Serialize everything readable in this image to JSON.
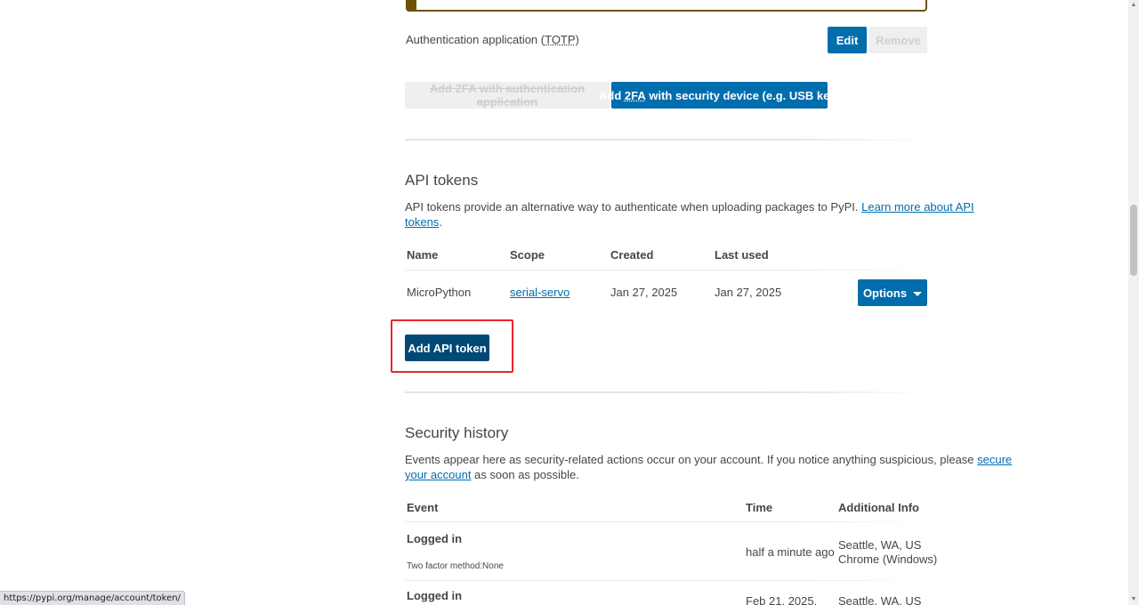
{
  "twofa": {
    "totp_label": "Authentication application (",
    "totp_abbr": "TOTP",
    "totp_close": ")",
    "edit_label": "Edit",
    "remove_label": "Remove",
    "add_app_label": "Add 2FA with authentication application",
    "add_device_prefix": "Add ",
    "add_device_abbr": "2FA",
    "add_device_suffix": " with security device (e.g. USB key)"
  },
  "api_tokens": {
    "heading": "API tokens",
    "desc_line1": "API tokens provide an alternative way to authenticate when uploading packages to PyPI. ",
    "desc_link1": "Learn more about API",
    "desc_link2": "tokens",
    "desc_end": ".",
    "columns": [
      "Name",
      "Scope",
      "Created",
      "Last used"
    ],
    "rows": [
      {
        "name": "MicroPython",
        "scope": "serial-servo",
        "created": "Jan 27, 2025",
        "last_used": "Jan 27, 2025",
        "options_label": "Options"
      }
    ],
    "add_label": "Add API token"
  },
  "security_history": {
    "heading": "Security history",
    "desc_line1": "Events appear here as security-related actions occur on your account. If you notice anything suspicious, please ",
    "desc_link1": "secure",
    "desc_link2": "your account",
    "desc_end": " as soon as possible.",
    "columns": [
      "Event",
      "Time",
      "Additional Info"
    ],
    "rows": [
      {
        "event": "Logged in",
        "detail": "Two factor method:None",
        "time": "half a minute ago",
        "location": "Seattle, WA, US",
        "browser": "Chrome (Windows)"
      },
      {
        "event": "Logged in",
        "time": "Feb 21, 2025,",
        "location": "Seattle, WA, US"
      }
    ]
  },
  "statusbar": {
    "url": "https://pypi.org/manage/account/token/"
  },
  "colors": {
    "primary": "#006dad",
    "primary_dark": "#004976",
    "callout_border": "#6b5300",
    "highlight": "#e8262c"
  }
}
